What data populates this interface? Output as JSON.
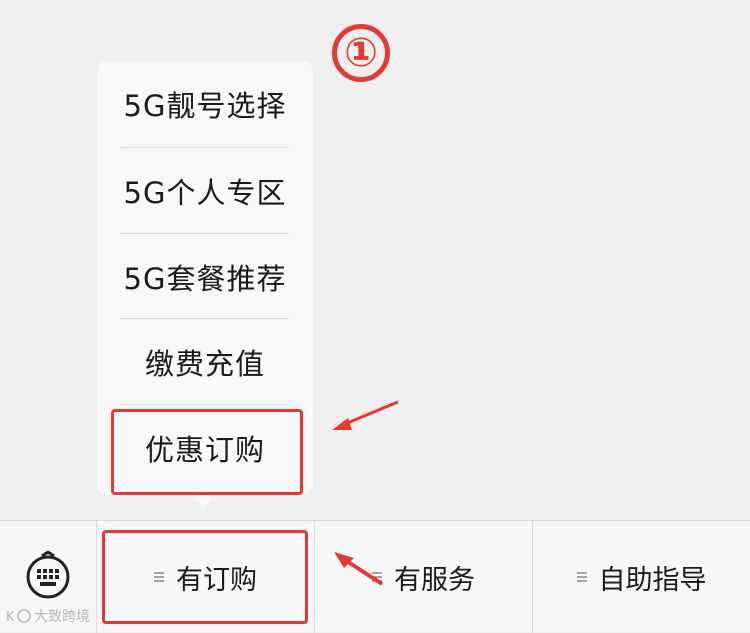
{
  "annotation": {
    "step_marker": "①"
  },
  "menu": {
    "items": [
      {
        "label": "5G靓号选择"
      },
      {
        "label": "5G个人专区"
      },
      {
        "label": "5G套餐推荐"
      },
      {
        "label": "缴费充值"
      },
      {
        "label": "优惠订购"
      }
    ]
  },
  "tabbar": {
    "keyboard_icon": "keyboard-icon",
    "tabs": [
      {
        "label": "有订购",
        "icon": "menu-lines-icon"
      },
      {
        "label": "有服务",
        "icon": "menu-lines-icon"
      },
      {
        "label": "自助指导",
        "icon": "menu-lines-icon"
      }
    ]
  },
  "watermark": {
    "text": "大致跨境"
  },
  "colors": {
    "annotation_red": "#e53935",
    "background": "#efefef",
    "menu_bg": "#f8f8f8"
  }
}
